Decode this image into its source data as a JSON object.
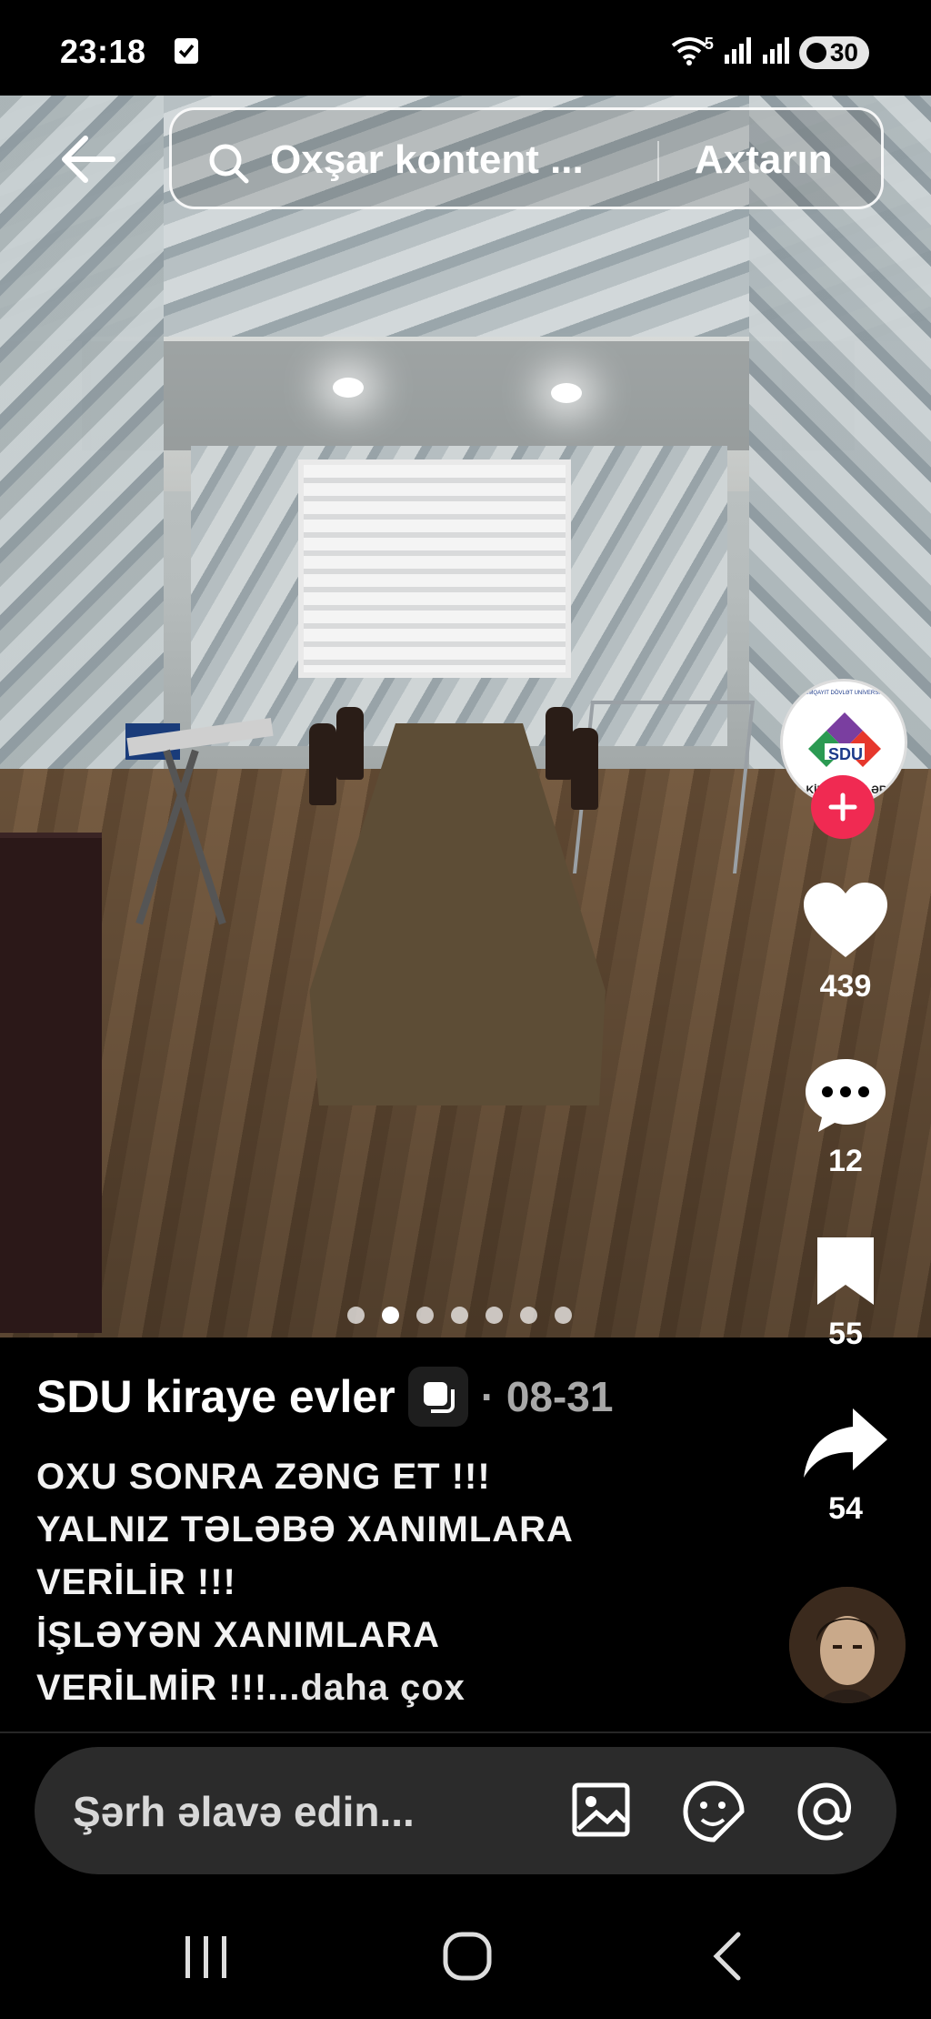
{
  "status_bar": {
    "time": "23:18",
    "battery": "30",
    "wifi_badge": "5"
  },
  "search": {
    "placeholder": "Oxşar kontent ...",
    "button_label": "Axtarın"
  },
  "carousel": {
    "total": 7,
    "active_index": 1
  },
  "actions": {
    "likes": "439",
    "comments": "12",
    "bookmarks": "55",
    "shares": "54"
  },
  "post": {
    "author": "SDU kiraye evler",
    "date_sep": "·",
    "date": "08-31",
    "caption_lines": [
      "OXU SONRA ZƏNG ET !!!",
      "YALNIZ TƏLƏBƏ XANIMLARA",
      "VERİLİR !!!",
      "İŞLƏYƏN XANIMLARA"
    ],
    "caption_last": "VERİLMİR !!!",
    "more_label": "...daha çox"
  },
  "avatar_logo": {
    "top_text": "SUMQAYIT DÖVLƏT UNİVERSİTETİ",
    "center_text": "SDU",
    "bottom_text": "KİRAYƏ EVLƏR"
  },
  "comment": {
    "placeholder": "Şərh əlavə edin..."
  },
  "colors": {
    "accent": "#f02a52",
    "background": "#000000",
    "input_bg": "#2b2b2b"
  }
}
